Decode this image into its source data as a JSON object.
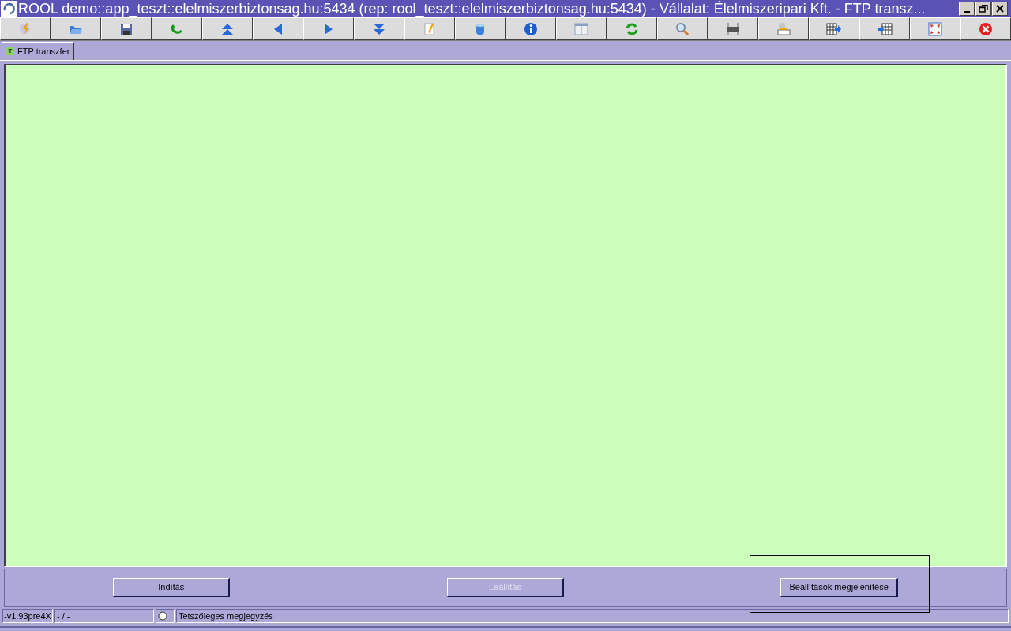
{
  "window": {
    "title": "ROOL demo::app_teszt::elelmiszerbiztonsag.hu:5434 (rep: rool_teszt::elelmiszerbiztonsag.hu:5434) - Vállalat: Élelmiszeripari Kft. - FTP transz..."
  },
  "tabs": [
    {
      "label": "FTP transzfer",
      "icon_letter": "T",
      "selected": true
    }
  ],
  "buttons": [
    {
      "label": "Indítás",
      "disabled": false,
      "focused": false
    },
    {
      "label": "Leállítás",
      "disabled": true,
      "focused": false
    },
    {
      "label": "Beállítások megjelenítése",
      "disabled": false,
      "focused": true
    }
  ],
  "status_bar": {
    "version": "-v1.93pre4X",
    "position": "- / -",
    "note": "Tetszőleges megjegyzés"
  }
}
